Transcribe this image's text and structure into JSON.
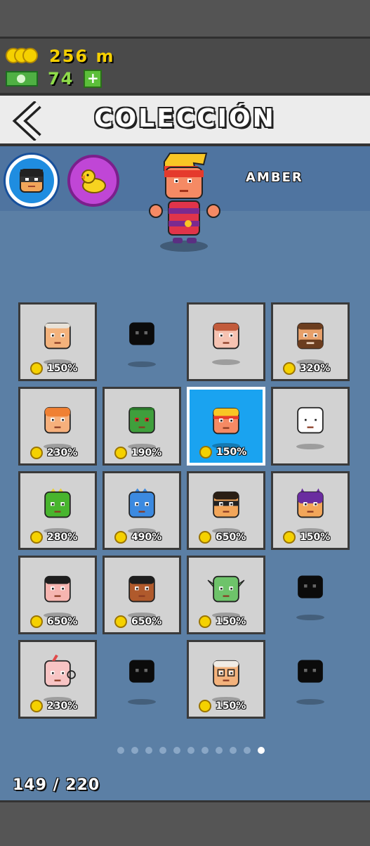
{
  "currency": {
    "coins": "256 m",
    "cash": "74",
    "plus_label": "+"
  },
  "header": {
    "title": "COLECCIÓN"
  },
  "selected_character": {
    "name": "AMBER"
  },
  "characters": [
    {
      "percent": "150%",
      "state": "owned",
      "face": "old-man"
    },
    {
      "percent": "",
      "state": "locked",
      "face": "locked-silhouette"
    },
    {
      "percent": "",
      "state": "owned",
      "face": "redhead-freckles"
    },
    {
      "percent": "320%",
      "state": "owned",
      "face": "bearded-man"
    },
    {
      "percent": "230%",
      "state": "owned",
      "face": "orange-hair"
    },
    {
      "percent": "190%",
      "state": "owned",
      "face": "green-creeper"
    },
    {
      "percent": "150%",
      "state": "selected",
      "face": "amber"
    },
    {
      "percent": "",
      "state": "owned",
      "face": "white-cube"
    },
    {
      "percent": "280%",
      "state": "owned",
      "face": "green-dino"
    },
    {
      "percent": "490%",
      "state": "owned",
      "face": "blue-monster"
    },
    {
      "percent": "650%",
      "state": "owned",
      "face": "masked-hero"
    },
    {
      "percent": "150%",
      "state": "owned",
      "face": "purple-cat"
    },
    {
      "percent": "650%",
      "state": "owned",
      "face": "black-hair-man"
    },
    {
      "percent": "650%",
      "state": "owned",
      "face": "dark-hair-woman"
    },
    {
      "percent": "150%",
      "state": "owned",
      "face": "green-alien"
    },
    {
      "percent": "",
      "state": "locked",
      "face": "locked-silhouette"
    },
    {
      "percent": "230%",
      "state": "owned",
      "face": "cup-character"
    },
    {
      "percent": "",
      "state": "locked",
      "face": "locked-silhouette"
    },
    {
      "percent": "150%",
      "state": "owned",
      "face": "old-glasses-man"
    },
    {
      "percent": "",
      "state": "locked",
      "face": "locked-silhouette"
    }
  ],
  "pagination": {
    "pages": 11,
    "current": 11
  },
  "counter": "149 / 220",
  "colors": {
    "background": "#5b7fa5",
    "coin": "#f5d100",
    "selected_cell": "#1aa3f0",
    "owned_cell": "#d2d2d2"
  }
}
